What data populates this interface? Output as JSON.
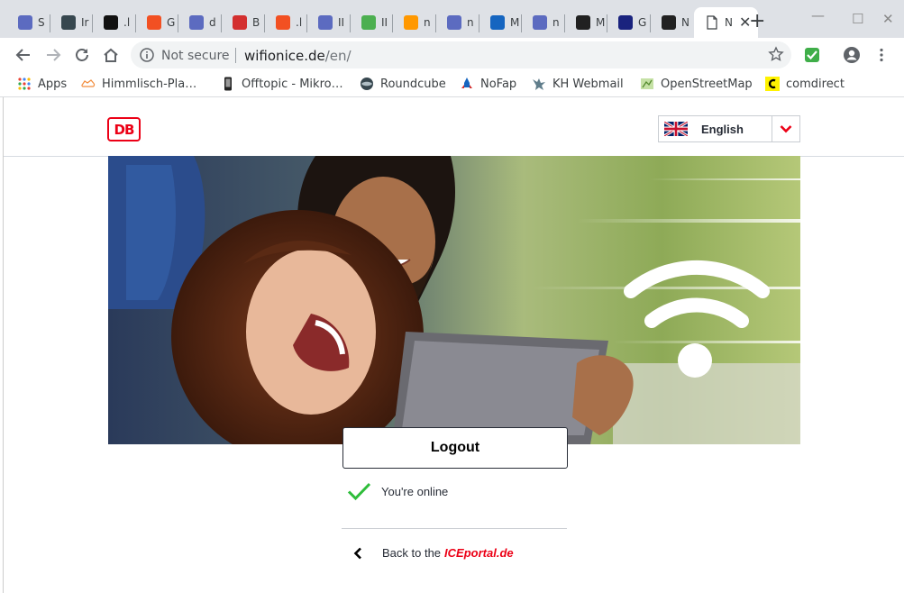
{
  "browser": {
    "tabs": [
      {
        "label": "S",
        "favicon_color": "#5c6bc0",
        "favicon": "generic-app-icon"
      },
      {
        "label": "Ir",
        "favicon_color": "#37474f",
        "favicon": "terminal-icon"
      },
      {
        "label": ".l",
        "favicon_color": "#111111",
        "favicon": "m-logo-icon"
      },
      {
        "label": "G",
        "favicon_color": "#f25022",
        "favicon": "windows-grid-icon"
      },
      {
        "label": "d",
        "favicon_color": "#5c6bc0",
        "favicon": "generic-app-icon"
      },
      {
        "label": "B",
        "favicon_color": "#d32f2f",
        "favicon": "red-logo-icon"
      },
      {
        "label": ".l",
        "favicon_color": "#f25022",
        "favicon": "windows-grid-icon"
      },
      {
        "label": "II",
        "favicon_color": "#5c6bc0",
        "favicon": "generic-app-icon"
      },
      {
        "label": "II",
        "favicon_color": "#4caf50",
        "favicon": "colorful-triangle-icon"
      },
      {
        "label": "n",
        "favicon_color": "#ff9800",
        "favicon": "diamond-icon"
      },
      {
        "label": "n",
        "favicon_color": "#5c6bc0",
        "favicon": "generic-app-icon"
      },
      {
        "label": "M",
        "favicon_color": "#1565c0",
        "favicon": "pen-icon"
      },
      {
        "label": "n",
        "favicon_color": "#5c6bc0",
        "favicon": "generic-app-icon"
      },
      {
        "label": "M",
        "favicon_color": "#212121",
        "favicon": "terminal-icon"
      },
      {
        "label": "G",
        "favicon_color": "#1a237e",
        "favicon": "gmx-icon"
      },
      {
        "label": "N",
        "favicon_color": "#212121",
        "favicon": "phone-icon"
      }
    ],
    "active_tab": {
      "label": "N",
      "favicon": "document-icon"
    },
    "omnibox": {
      "security_text": "Not secure",
      "url_host": "wifionice.de",
      "url_path": "/en/"
    },
    "bookmarks": [
      {
        "label": "Apps",
        "icon": "apps-grid-icon"
      },
      {
        "label": "Himmlisch-Pla…",
        "icon": "cloud-icon"
      },
      {
        "label": "Offtopic - Mikro…",
        "icon": "phone-icon"
      },
      {
        "label": "Roundcube",
        "icon": "roundcube-icon"
      },
      {
        "label": "NoFap",
        "icon": "rocket-icon"
      },
      {
        "label": "KH Webmail",
        "icon": "bird-icon"
      },
      {
        "label": "OpenStreetMap",
        "icon": "map-icon"
      },
      {
        "label": "comdirect",
        "icon": "c-logo-icon"
      }
    ]
  },
  "page": {
    "logo_text": "DB",
    "language": {
      "selected": "English",
      "flag": "uk-flag-icon"
    },
    "hero": {
      "image": "couple-with-tablet-wifi-photo",
      "icon": "wifi-icon"
    },
    "logout_label": "Logout",
    "status_text": "You're online",
    "back_prefix": "Back to the",
    "back_brand": "ICEportal.de",
    "colors": {
      "accent": "#ec0016",
      "check": "#2ebd3a",
      "text": "#282d37"
    }
  }
}
